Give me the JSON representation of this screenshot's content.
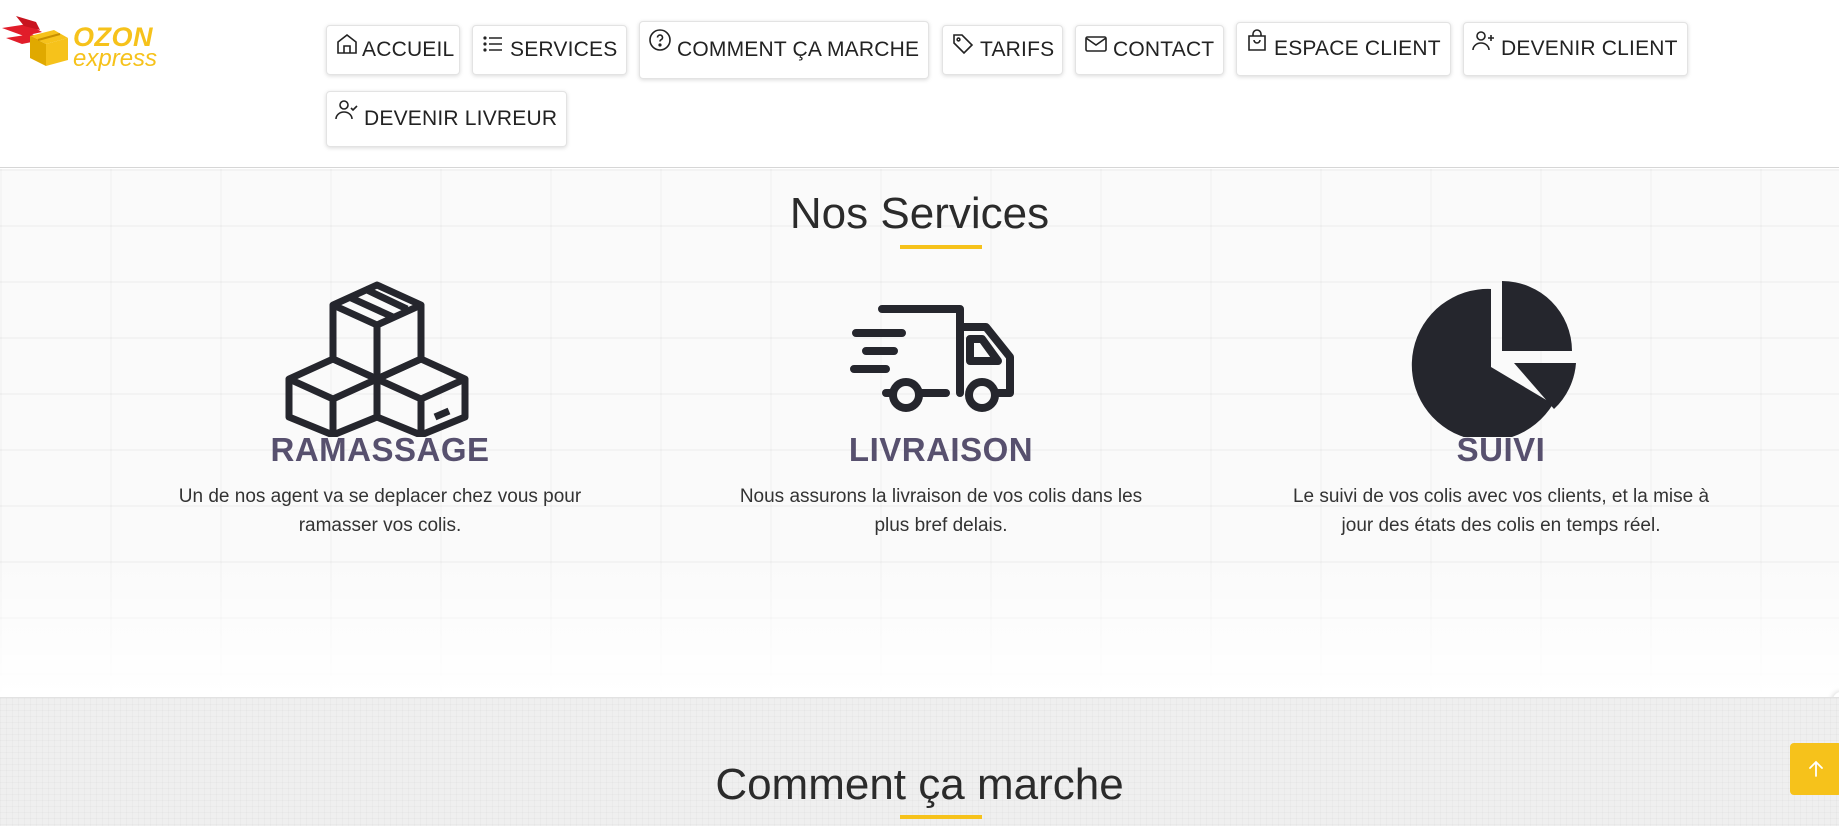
{
  "brand": {
    "name_line1": "OZON",
    "name_line2": "express",
    "color": "#f6c21b",
    "wing_color": "#e11d2a"
  },
  "nav": {
    "items": [
      {
        "label": "ACCUEIL",
        "icon": "home-icon"
      },
      {
        "label": "SERVICES",
        "icon": "list-icon"
      },
      {
        "label": "COMMENT ÇA MARCHE",
        "icon": "help-circle-icon"
      },
      {
        "label": "TARIFS",
        "icon": "tag-icon"
      },
      {
        "label": "CONTACT",
        "icon": "envelope-icon"
      },
      {
        "label": "ESPACE CLIENT",
        "icon": "shopping-bag-icon"
      },
      {
        "label": "DEVENIR CLIENT",
        "icon": "user-plus-icon"
      },
      {
        "label": "DEVENIR LIVREUR",
        "icon": "user-check-icon"
      }
    ]
  },
  "services": {
    "title": "Nos Services",
    "items": [
      {
        "icon": "boxes-icon",
        "title": "RAMASSAGE",
        "desc_line1": "Un de nos agent va se deplacer chez vous pour",
        "desc_line2": "ramasser vos colis."
      },
      {
        "icon": "delivery-truck-icon",
        "title": "LIVRAISON",
        "desc_line1": "Nous assurons la livraison de vos colis dans les",
        "desc_line2": "plus bref delais."
      },
      {
        "icon": "pie-chart-icon",
        "title": "SUIVI",
        "desc_line1": "Le suivi de vos colis avec vos clients, et la mise à",
        "desc_line2": "jour des états des colis en temps réel."
      }
    ]
  },
  "how_it_works": {
    "title": "Comment ça marche"
  },
  "colors": {
    "accent": "#f6c21b",
    "service_title": "#57506e",
    "icon_dark": "#25262d"
  }
}
